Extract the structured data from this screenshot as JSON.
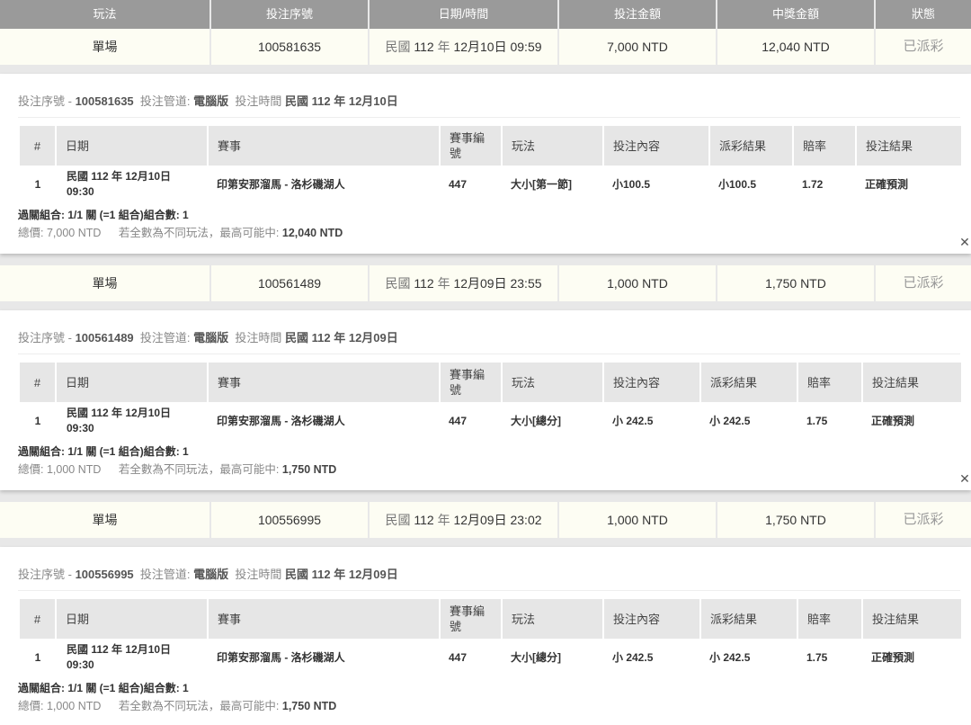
{
  "header": {
    "col_play": "玩法",
    "col_bet_no": "投注序號",
    "col_datetime": "日期/時間",
    "col_amount": "投注金額",
    "col_win": "中獎金額",
    "col_status": "狀態"
  },
  "detail_labels": {
    "bet_no": "投注序號",
    "channel": "投注管道:",
    "bet_time": "投注時間",
    "th_index": "#",
    "th_date": "日期",
    "th_match": "賽事",
    "th_match_no": "賽事編號",
    "th_play": "玩法",
    "th_content": "投注內容",
    "th_result": "派彩結果",
    "th_odds": "賠率",
    "th_bet_result": "投注結果",
    "total_label": "總價:",
    "max_win_note": "若全數為不同玩法，最高可能中:"
  },
  "bets": [
    {
      "play": "單場",
      "bet_no": "100581635",
      "datetime_prefix": "民國",
      "datetime_year": "112",
      "datetime_year_unit": "年",
      "datetime_rest": "12月10日 09:59",
      "amount": "7,000 NTD",
      "win": "12,040 NTD",
      "status": "已派彩",
      "detail": {
        "bet_no": "100581635",
        "channel": "電腦版",
        "bet_time": "民國 112 年 12月10日",
        "row": {
          "index": "1",
          "date_line1": "民國 112 年 12月10日",
          "date_line2": "09:30",
          "match": "印第安那溜馬 - 洛杉磯湖人",
          "match_no": "447",
          "play": "大小[第一節]",
          "content": "小100.5",
          "result": "小100.5",
          "odds": "1.72",
          "bet_result": "正確預測"
        },
        "combo": "過關組合: 1/1 關 (=1 組合)組合數: 1",
        "total": "7,000 NTD",
        "max_win": "12,040 NTD"
      }
    },
    {
      "play": "單場",
      "bet_no": "100561489",
      "datetime_prefix": "民國",
      "datetime_year": "112",
      "datetime_year_unit": "年",
      "datetime_rest": "12月09日 23:55",
      "amount": "1,000 NTD",
      "win": "1,750 NTD",
      "status": "已派彩",
      "detail": {
        "bet_no": "100561489",
        "channel": "電腦版",
        "bet_time": "民國 112 年 12月09日",
        "row": {
          "index": "1",
          "date_line1": "民國 112 年 12月10日",
          "date_line2": "09:30",
          "match": "印第安那溜馬 - 洛杉磯湖人",
          "match_no": "447",
          "play": "大小[總分]",
          "content": "小 242.5",
          "result": "小 242.5",
          "odds": "1.75",
          "bet_result": "正確預測"
        },
        "combo": "過關組合: 1/1 關 (=1 組合)組合數: 1",
        "total": "1,000 NTD",
        "max_win": "1,750 NTD"
      }
    },
    {
      "play": "單場",
      "bet_no": "100556995",
      "datetime_prefix": "民國",
      "datetime_year": "112",
      "datetime_year_unit": "年",
      "datetime_rest": "12月09日 23:02",
      "amount": "1,000 NTD",
      "win": "1,750 NTD",
      "status": "已派彩",
      "detail": {
        "bet_no": "100556995",
        "channel": "電腦版",
        "bet_time": "民國 112 年 12月09日",
        "row": {
          "index": "1",
          "date_line1": "民國 112 年 12月10日",
          "date_line2": "09:30",
          "match": "印第安那溜馬 - 洛杉磯湖人",
          "match_no": "447",
          "play": "大小[總分]",
          "content": "小 242.5",
          "result": "小 242.5",
          "odds": "1.75",
          "bet_result": "正確預測"
        },
        "combo": "過關組合: 1/1 關 (=1 組合)組合數: 1",
        "total": "1,000 NTD",
        "max_win": "1,750 NTD"
      }
    }
  ],
  "icons": {
    "close": "close-icon"
  }
}
